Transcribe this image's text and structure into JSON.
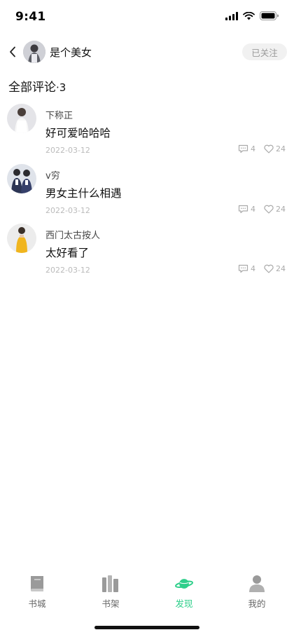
{
  "status_bar": {
    "time": "9:41"
  },
  "header": {
    "author_name": "是个美女",
    "follow_label": "已关注"
  },
  "section": {
    "title": "全部评论",
    "count": "·3"
  },
  "comments": [
    {
      "user": "下称正",
      "text": "好可爱哈哈哈",
      "date": "2022-03-12",
      "replies": "4",
      "likes": "24"
    },
    {
      "user": "v穷",
      "text": "男女主什么相遇",
      "date": "2022-03-12",
      "replies": "4",
      "likes": "24"
    },
    {
      "user": "西门太古按人",
      "text": "太好看了",
      "date": "2022-03-12",
      "replies": "4",
      "likes": "24"
    }
  ],
  "tabbar": {
    "items": [
      {
        "label": "书城",
        "icon": "book-icon"
      },
      {
        "label": "书架",
        "icon": "bookshelf-icon"
      },
      {
        "label": "发现",
        "icon": "planet-icon"
      },
      {
        "label": "我的",
        "icon": "person-icon"
      }
    ],
    "active_index": 2,
    "active_color": "#2fcf8b"
  }
}
